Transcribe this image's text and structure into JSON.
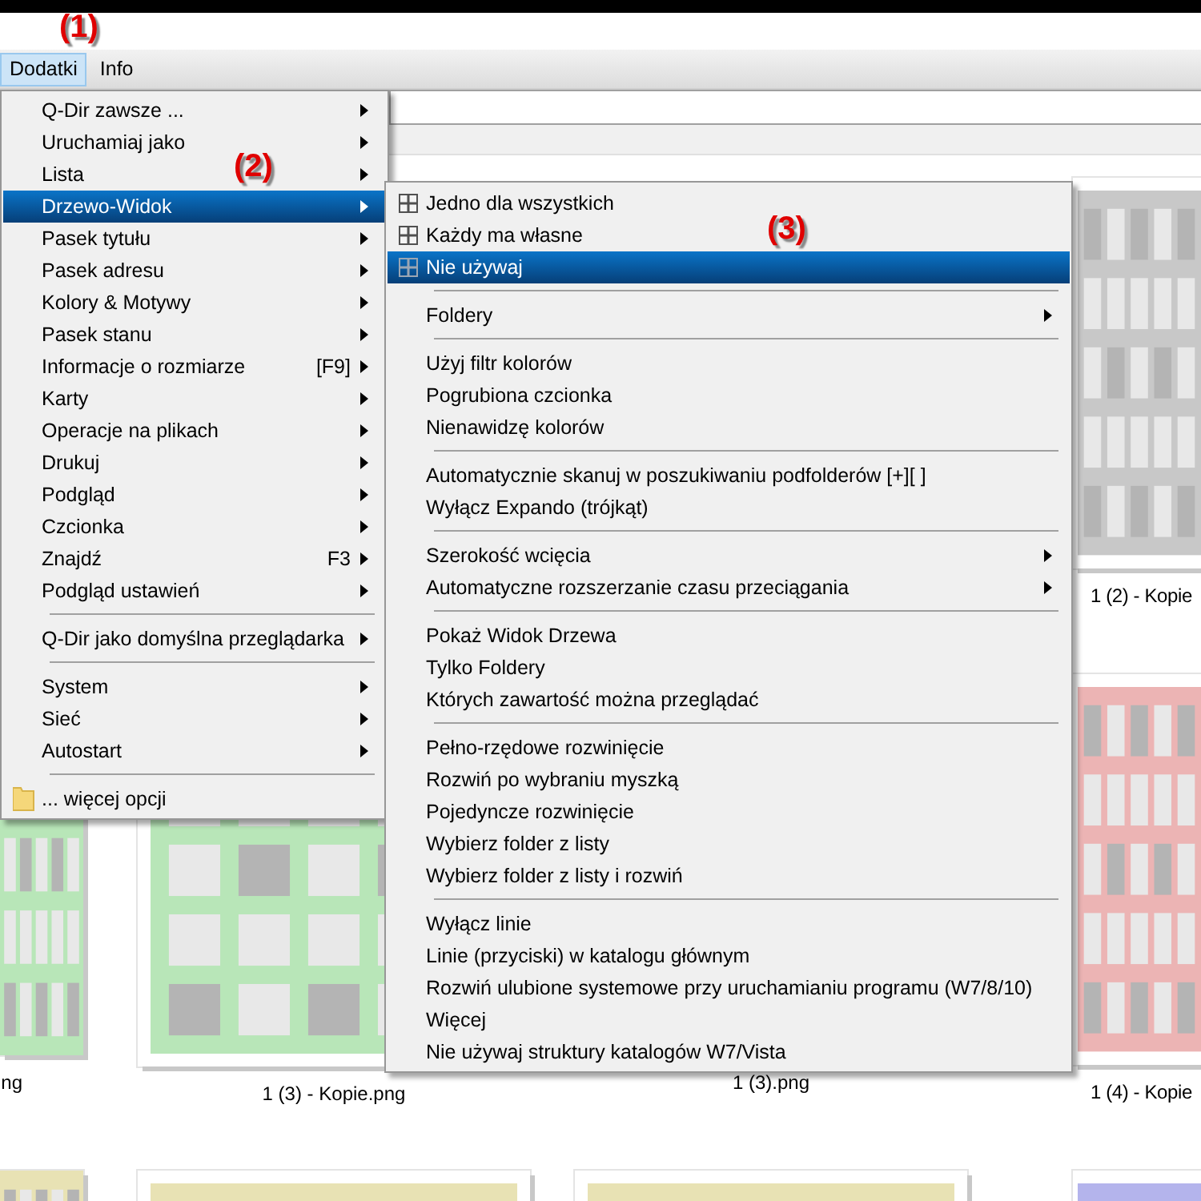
{
  "annotations": [
    "(1)",
    "(2)",
    "(3)"
  ],
  "menubar": [
    {
      "label": "Dodatki",
      "selected": true
    },
    {
      "label": "Info",
      "selected": false
    }
  ],
  "menu": [
    {
      "kind": "item",
      "label": "Q-Dir zawsze ...",
      "submenu": true,
      "selected": false
    },
    {
      "kind": "item",
      "label": "Uruchamiaj jako",
      "submenu": true,
      "selected": false
    },
    {
      "kind": "item",
      "label": "Lista",
      "submenu": true,
      "selected": false
    },
    {
      "kind": "item",
      "label": "Drzewo-Widok",
      "submenu": true,
      "selected": true
    },
    {
      "kind": "item",
      "label": "Pasek tytułu",
      "submenu": true,
      "selected": false
    },
    {
      "kind": "item",
      "label": "Pasek adresu",
      "submenu": true,
      "selected": false
    },
    {
      "kind": "item",
      "label": "Kolory & Motywy",
      "submenu": true,
      "selected": false
    },
    {
      "kind": "item",
      "label": "Pasek stanu",
      "submenu": true,
      "selected": false
    },
    {
      "kind": "item",
      "label": "Informacje o rozmiarze",
      "shortcut": "[F9]",
      "submenu": true,
      "selected": false
    },
    {
      "kind": "item",
      "label": "Karty",
      "submenu": true,
      "selected": false
    },
    {
      "kind": "item",
      "label": "Operacje na plikach",
      "submenu": true,
      "selected": false
    },
    {
      "kind": "item",
      "label": "Drukuj",
      "submenu": true,
      "selected": false
    },
    {
      "kind": "item",
      "label": "Podgląd",
      "submenu": true,
      "selected": false
    },
    {
      "kind": "item",
      "label": "Czcionka",
      "submenu": true,
      "selected": false
    },
    {
      "kind": "item",
      "label": "Znajdź",
      "shortcut": "F3",
      "submenu": true,
      "selected": false
    },
    {
      "kind": "item",
      "label": "Podgląd ustawień",
      "submenu": true,
      "selected": false
    },
    {
      "kind": "separator"
    },
    {
      "kind": "item",
      "label": "Q-Dir jako domyślna przeglądarka",
      "submenu": true,
      "selected": false
    },
    {
      "kind": "separator"
    },
    {
      "kind": "item",
      "label": "System",
      "submenu": true,
      "selected": false
    },
    {
      "kind": "item",
      "label": "Sieć",
      "submenu": true,
      "selected": false
    },
    {
      "kind": "item",
      "label": "Autostart",
      "submenu": true,
      "selected": false
    },
    {
      "kind": "separator"
    },
    {
      "kind": "folder-item",
      "label": "... więcej opcji",
      "submenu": false,
      "selected": false
    }
  ],
  "submenu": [
    {
      "kind": "icon-item",
      "label": "Jedno dla wszystkich",
      "submenu": false,
      "selected": false
    },
    {
      "kind": "icon-item",
      "label": "Każdy ma własne",
      "submenu": false,
      "selected": false
    },
    {
      "kind": "icon-item",
      "label": "Nie używaj",
      "submenu": false,
      "selected": true
    },
    {
      "kind": "separator"
    },
    {
      "kind": "item",
      "label": "Foldery",
      "submenu": true,
      "selected": false
    },
    {
      "kind": "separator"
    },
    {
      "kind": "item",
      "label": "Użyj filtr kolorów",
      "submenu": false,
      "selected": false
    },
    {
      "kind": "item",
      "label": "Pogrubiona czcionka",
      "submenu": false,
      "selected": false
    },
    {
      "kind": "item",
      "label": "Nienawidzę kolorów",
      "submenu": false,
      "selected": false
    },
    {
      "kind": "separator"
    },
    {
      "kind": "item",
      "label": "Automatycznie skanuj w poszukiwaniu podfolderów [+][ ]",
      "submenu": false,
      "selected": false
    },
    {
      "kind": "item",
      "label": "Wyłącz Expando (trójkąt)",
      "submenu": false,
      "selected": false
    },
    {
      "kind": "separator"
    },
    {
      "kind": "item",
      "label": "Szerokość wcięcia",
      "submenu": true,
      "selected": false
    },
    {
      "kind": "item",
      "label": "Automatyczne rozszerzanie czasu przeciągania",
      "submenu": true,
      "selected": false
    },
    {
      "kind": "separator"
    },
    {
      "kind": "item",
      "label": "Pokaż Widok Drzewa",
      "submenu": false,
      "selected": false
    },
    {
      "kind": "item",
      "label": "Tylko Foldery",
      "submenu": false,
      "selected": false
    },
    {
      "kind": "item",
      "label": "Których zawartość można przeglądać",
      "submenu": false,
      "selected": false
    },
    {
      "kind": "separator"
    },
    {
      "kind": "item",
      "label": "Pełno-rzędowe rozwinięcie",
      "submenu": false,
      "selected": false
    },
    {
      "kind": "item",
      "label": "Rozwiń po wybraniu myszką",
      "submenu": false,
      "selected": false
    },
    {
      "kind": "item",
      "label": "Pojedyncze rozwinięcie",
      "submenu": false,
      "selected": false
    },
    {
      "kind": "item",
      "label": "Wybierz folder z listy",
      "submenu": false,
      "selected": false
    },
    {
      "kind": "item",
      "label": "Wybierz folder z listy i rozwiń",
      "submenu": false,
      "selected": false
    },
    {
      "kind": "separator"
    },
    {
      "kind": "item",
      "label": "Wyłącz linie",
      "submenu": false,
      "selected": false
    },
    {
      "kind": "item",
      "label": "Linie (przyciski) w katalogu głównym",
      "submenu": false,
      "selected": false
    },
    {
      "kind": "item",
      "label": "Rozwiń ulubione systemowe przy uruchamianiu programu (W7/8/10)",
      "submenu": false,
      "selected": false
    },
    {
      "kind": "item",
      "label": "Więcej",
      "submenu": false,
      "selected": false
    },
    {
      "kind": "item",
      "label": "Nie używaj struktury katalogów W7/Vista",
      "submenu": false,
      "selected": false
    }
  ],
  "file_rows": [
    {
      "items": [
        {
          "color": "#c8c8c8",
          "label": "1 (2) - Kopie"
        }
      ]
    },
    {
      "items": [
        {
          "color": "#b8e6b8",
          "label": "ng"
        },
        {
          "color": "#b8e6b8",
          "label": "1 (3) - Kopie.png"
        },
        {
          "label": "1 (3).png"
        },
        {
          "color": "#ecb4b4",
          "label": "1 (4) - Kopie"
        }
      ]
    },
    {
      "items": [
        {
          "color": "#e8e2b4"
        },
        {
          "color": "#e8e2b4"
        },
        {
          "color": "#e8e2b4"
        },
        {
          "color": "#b4b4ec"
        }
      ]
    }
  ]
}
